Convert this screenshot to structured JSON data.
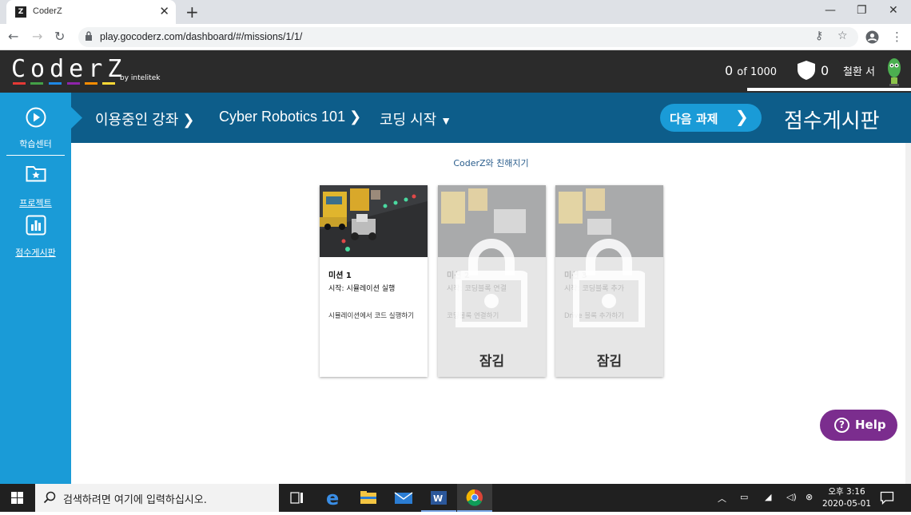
{
  "browser": {
    "tab_title": "CoderZ",
    "url": "play.gocoderz.com/dashboard/#/missions/1/1/"
  },
  "header": {
    "logo": "CoderZ",
    "byline": "by intelitek",
    "score_value": "0",
    "score_suffix": "of 1000",
    "shield_count": "0",
    "username": "철환 서"
  },
  "sidebar": {
    "items": [
      {
        "label": "학습센터",
        "icon": "play-circle-icon"
      },
      {
        "label": "프로젝트",
        "icon": "folder-star-icon"
      },
      {
        "label": "점수게시판",
        "icon": "bar-chart-icon"
      }
    ]
  },
  "breadcrumb": {
    "course": "이용중인 강좌",
    "subject": "Cyber Robotics 101",
    "section": "코딩 시작"
  },
  "next_button": "다음 과제",
  "leaderboard_title": "점수게시판",
  "subtitle": "CoderZ와 친해지기",
  "missions": [
    {
      "title": "미션 1",
      "subtitle": "시작: 시뮬레이션 실행",
      "description": "시뮬레이션에서 코드 실행하기",
      "locked": false
    },
    {
      "title": "미션 2",
      "subtitle": "시작: 코딩블록 연결",
      "description": "코딩블록 연결하기",
      "locked": true,
      "lock_label": "잠김"
    },
    {
      "title": "미션 3",
      "subtitle": "시작: 코딩블록 추가",
      "description": "Drive 블록 추가하기",
      "locked": true,
      "lock_label": "잠김"
    }
  ],
  "help_label": "Help",
  "taskbar": {
    "search_placeholder": "검색하려면 여기에 입력하십시오.",
    "time": "오후 3:16",
    "date": "2020-05-01"
  },
  "colors": {
    "sidebar": "#1a9bd7",
    "breadcrumb_bar": "#0d5d8a",
    "header": "#2b2b2b",
    "help": "#7b2d8e"
  }
}
